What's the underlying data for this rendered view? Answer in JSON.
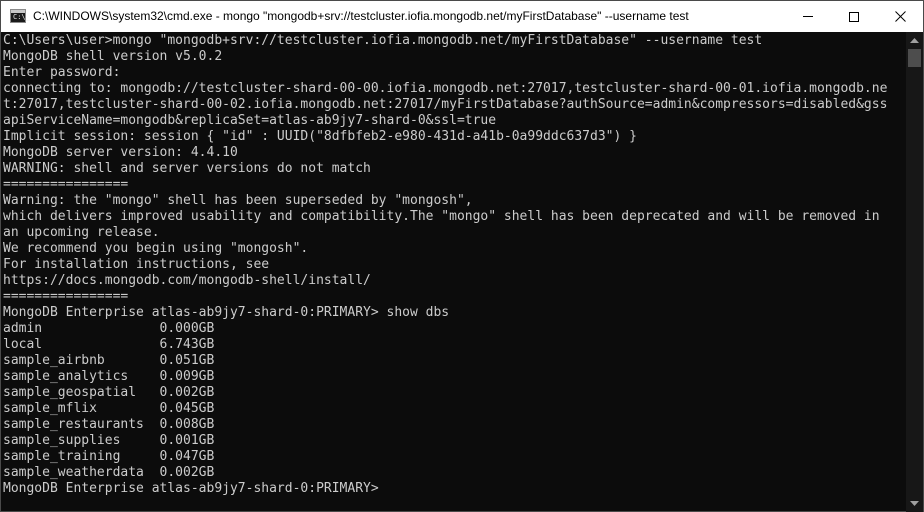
{
  "window": {
    "title": "C:\\WINDOWS\\system32\\cmd.exe - mongo  \"mongodb+srv://testcluster.iofia.mongodb.net/myFirstDatabase\" --username test",
    "app_icon_glyph": "C:\\_",
    "icons": {
      "app": "cmd-icon",
      "minimize": "minimize-icon",
      "maximize": "maximize-icon",
      "close": "close-icon"
    }
  },
  "colors": {
    "background": "#0c0c0c",
    "foreground": "#cccccc",
    "titlebar": "#ffffff"
  },
  "console": {
    "lines": [
      "C:\\Users\\user>mongo \"mongodb+srv://testcluster.iofia.mongodb.net/myFirstDatabase\" --username test",
      "MongoDB shell version v5.0.2",
      "Enter password:",
      "connecting to: mongodb://testcluster-shard-00-00.iofia.mongodb.net:27017,testcluster-shard-00-01.iofia.mongodb.ne",
      "t:27017,testcluster-shard-00-02.iofia.mongodb.net:27017/myFirstDatabase?authSource=admin&compressors=disabled&gss",
      "apiServiceName=mongodb&replicaSet=atlas-ab9jy7-shard-0&ssl=true",
      "Implicit session: session { \"id\" : UUID(\"8dfbfeb2-e980-431d-a41b-0a99ddc637d3\") }",
      "MongoDB server version: 4.4.10",
      "WARNING: shell and server versions do not match",
      "================",
      "Warning: the \"mongo\" shell has been superseded by \"mongosh\",",
      "which delivers improved usability and compatibility.The \"mongo\" shell has been deprecated and will be removed in",
      "an upcoming release.",
      "We recommend you begin using \"mongosh\".",
      "For installation instructions, see",
      "https://docs.mongodb.com/mongodb-shell/install/",
      "================",
      "MongoDB Enterprise atlas-ab9jy7-shard-0:PRIMARY> show dbs",
      "admin               0.000GB",
      "local               6.743GB",
      "sample_airbnb       0.051GB",
      "sample_analytics    0.009GB",
      "sample_geospatial   0.002GB",
      "sample_mflix        0.045GB",
      "sample_restaurants  0.008GB",
      "sample_supplies     0.001GB",
      "sample_training     0.047GB",
      "sample_weatherdata  0.002GB",
      "MongoDB Enterprise atlas-ab9jy7-shard-0:PRIMARY>"
    ]
  }
}
